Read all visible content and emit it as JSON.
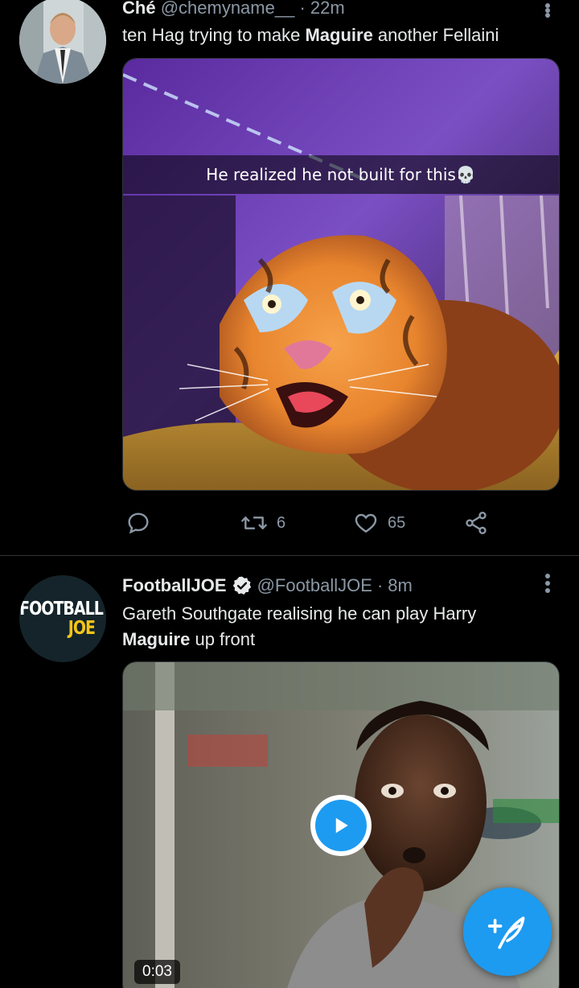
{
  "tweets": [
    {
      "author_name": "Ché",
      "author_handle": "@chemyname__",
      "separator": "·",
      "time": "22m",
      "text_before": "ten Hag trying to make ",
      "text_bold": "Maguire",
      "text_after": " another Fellaini",
      "media": {
        "type": "image",
        "caption": "He realized he not built for this💀"
      },
      "actions": {
        "reply_count": "",
        "retweet_count": "6",
        "like_count": "65"
      }
    },
    {
      "author_name": "FootballJOE",
      "verified": true,
      "author_handle": "@FootballJOE",
      "separator": "·",
      "time": "8m",
      "avatar_text_line1": "FOOTBALL",
      "avatar_text_line2": "JOE",
      "text_before": "Gareth Southgate realising he can play Harry ",
      "text_bold": "Maguire",
      "text_after": " up front",
      "media": {
        "type": "video",
        "duration": "0:03"
      }
    }
  ],
  "colors": {
    "accent": "#1d9bf0",
    "background": "#000000",
    "secondary_text": "#8b98a5"
  },
  "icons": {
    "compose": "feather-plus-icon",
    "reply": "reply-icon",
    "retweet": "retweet-icon",
    "like": "heart-icon",
    "share": "share-icon",
    "more": "more-vertical-icon",
    "play": "play-icon",
    "verified": "verified-badge-icon"
  }
}
